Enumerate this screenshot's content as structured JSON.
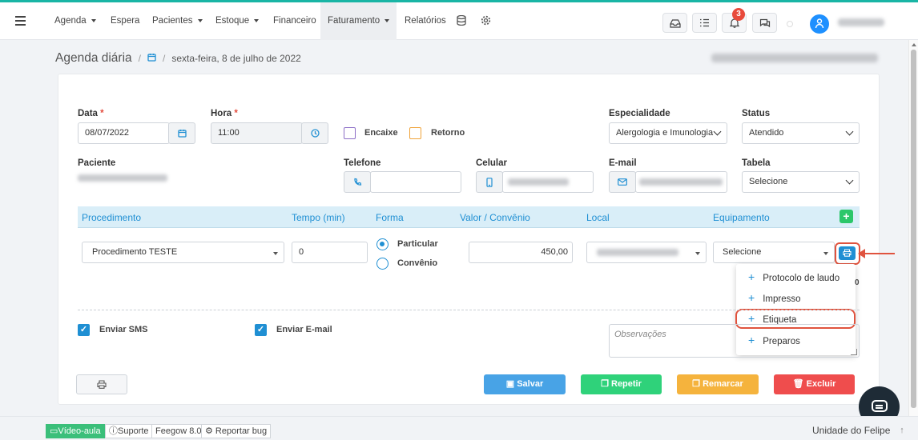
{
  "nav": {
    "items": [
      {
        "label": "Agenda",
        "caret": true
      },
      {
        "label": "Espera",
        "caret": false
      },
      {
        "label": "Pacientes",
        "caret": true
      },
      {
        "label": "Estoque",
        "caret": true
      },
      {
        "label": "Financeiro",
        "caret": false
      },
      {
        "label": "Faturamento",
        "caret": true,
        "active": true
      },
      {
        "label": "Relatórios",
        "caret": false
      }
    ],
    "notification_count": "3",
    "icons": [
      "database-icon",
      "gear-icon",
      "inbox-icon",
      "tasks-icon",
      "bell-icon",
      "chat-icon",
      "user-icon"
    ]
  },
  "breadcrumb": {
    "title": "Agenda diária",
    "date": "sexta-feira, 8 de julho de 2022"
  },
  "form": {
    "data_label": "Data",
    "data_value": "08/07/2022",
    "hora_label": "Hora",
    "hora_value": "11:00",
    "encaixe_label": "Encaixe",
    "retorno_label": "Retorno",
    "especialidade_label": "Especialidade",
    "especialidade_value": "Alergologia e Imunologia",
    "status_label": "Status",
    "status_value": "Atendido",
    "paciente_label": "Paciente",
    "telefone_label": "Telefone",
    "celular_label": "Celular",
    "email_label": "E-mail",
    "tabela_label": "Tabela",
    "tabela_value": "Selecione"
  },
  "procedures": {
    "headers": {
      "procedimento": "Procedimento",
      "tempo": "Tempo (min)",
      "forma": "Forma",
      "valor": "Valor / Convênio",
      "local": "Local",
      "equipamento": "Equipamento"
    },
    "row": {
      "procedimento": "Procedimento TESTE",
      "tempo": "0",
      "forma_particular": "Particular",
      "forma_convenio": "Convênio",
      "valor": "450,00",
      "equipamento": "Selecione"
    }
  },
  "print_menu": {
    "items": [
      "Protocolo de laudo",
      "Impresso",
      "Etiqueta",
      "Preparos"
    ],
    "peek": "0"
  },
  "options": {
    "sms": "Enviar SMS",
    "email": "Enviar E-mail",
    "obs_placeholder": "Observações"
  },
  "actions": {
    "salvar": "Salvar",
    "repetir": "Repetir",
    "remarcar": "Remarcar",
    "excluir": "Excluir"
  },
  "colors": {
    "salvar": "#48a3e6",
    "repetir": "#2fd27a",
    "remarcar": "#f5b33d",
    "excluir": "#ef4d4d",
    "accent": "#1f8fd3",
    "highlight": "#e0533e"
  },
  "footer": {
    "video": "Vídeo-aula",
    "suporte": "Suporte",
    "version": "Feegow 8.0",
    "bug": "Reportar bug",
    "unit": "Unidade do Felipe"
  }
}
